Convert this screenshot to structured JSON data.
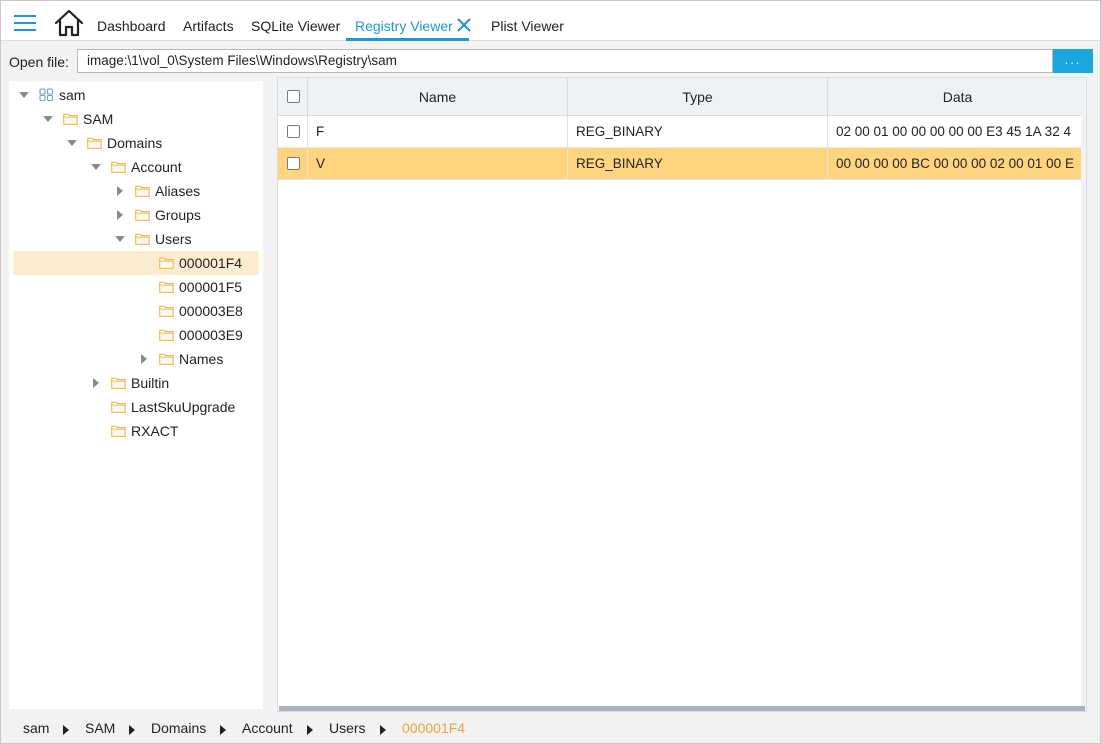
{
  "nav": {
    "tabs": [
      {
        "label": "Dashboard"
      },
      {
        "label": "Artifacts"
      },
      {
        "label": "SQLite Viewer"
      },
      {
        "label": "Registry Viewer",
        "active": true
      },
      {
        "label": "Plist Viewer"
      }
    ]
  },
  "open_file": {
    "label": "Open file:",
    "value": "image:\\1\\vol_0\\System Files\\Windows\\Registry\\sam",
    "browse_label": "..."
  },
  "tree": {
    "nodes": [
      {
        "label": "sam",
        "level": 0,
        "expanded": true,
        "icon": "hive-icon"
      },
      {
        "label": "SAM",
        "level": 1,
        "expanded": true,
        "icon": "folder-icon"
      },
      {
        "label": "Domains",
        "level": 2,
        "expanded": true,
        "icon": "folder-icon"
      },
      {
        "label": "Account",
        "level": 3,
        "expanded": true,
        "icon": "folder-icon"
      },
      {
        "label": "Aliases",
        "level": 4,
        "expanded": false,
        "icon": "folder-icon"
      },
      {
        "label": "Groups",
        "level": 4,
        "expanded": false,
        "icon": "folder-icon"
      },
      {
        "label": "Users",
        "level": 4,
        "expanded": true,
        "icon": "folder-icon"
      },
      {
        "label": "000001F4",
        "level": 5,
        "leaf": true,
        "selected": true,
        "icon": "folder-icon"
      },
      {
        "label": "000001F5",
        "level": 5,
        "leaf": true,
        "icon": "folder-icon"
      },
      {
        "label": "000003E8",
        "level": 5,
        "leaf": true,
        "icon": "folder-icon"
      },
      {
        "label": "000003E9",
        "level": 5,
        "leaf": true,
        "icon": "folder-icon"
      },
      {
        "label": "Names",
        "level": 5,
        "expanded": false,
        "icon": "folder-icon"
      },
      {
        "label": "Builtin",
        "level": 3,
        "expanded": false,
        "icon": "folder-icon"
      },
      {
        "label": "LastSkuUpgrade",
        "level": 3,
        "leaf": true,
        "icon": "folder-icon"
      },
      {
        "label": "RXACT",
        "level": 3,
        "leaf": true,
        "icon": "folder-icon"
      }
    ]
  },
  "grid": {
    "columns": [
      "Name",
      "Type",
      "Data"
    ],
    "rows": [
      {
        "name": "F",
        "type": "REG_BINARY",
        "data": "02 00 01 00 00 00 00 00 E3 45 1A 32 4",
        "selected": false
      },
      {
        "name": "V",
        "type": "REG_BINARY",
        "data": "00 00 00 00 BC 00 00 00 02 00 01 00 E",
        "selected": true
      }
    ]
  },
  "breadcrumb": {
    "items": [
      "sam",
      "SAM",
      "Domains",
      "Account",
      "Users",
      "000001F4"
    ]
  },
  "colors": {
    "accent": "#1e97d4",
    "selected_row": "#ffd47f",
    "selected_tree": "#fdedcf",
    "folder": "#f3b64d",
    "breadcrumb_current": "#f0a335"
  }
}
